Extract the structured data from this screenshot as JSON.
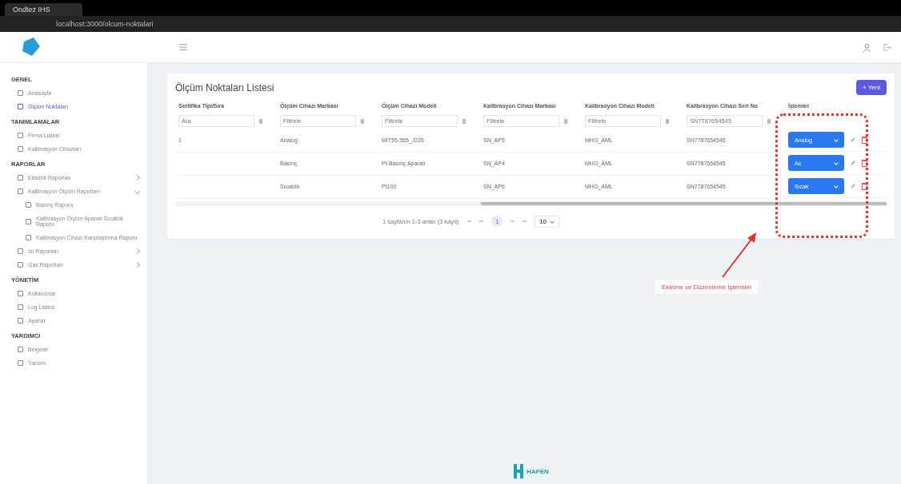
{
  "browser": {
    "tab_title": "Ondtez IHS",
    "address": "localhost:3000/olcum-noktalari"
  },
  "sidebar": {
    "sections": [
      {
        "title": "GENEL",
        "items": [
          {
            "kind": "link",
            "label": "Anasayfa",
            "selected": false
          },
          {
            "kind": "link",
            "label": "Ölçüm Noktaları",
            "selected": true
          }
        ]
      },
      {
        "title": "TANIMLAMALAR",
        "items": [
          {
            "kind": "link",
            "label": "Firma Listesi",
            "selected": false
          },
          {
            "kind": "link",
            "label": "Kalibrasyon Cihazları",
            "selected": false
          }
        ]
      },
      {
        "title": "RAPORLAR",
        "items": [
          {
            "kind": "group",
            "label": "Elektrik Raporları",
            "selected": false,
            "expanded": false
          },
          {
            "kind": "group",
            "label": "Kalibrasyon Ölçüm Raporları",
            "selected": false,
            "expanded": true,
            "children": [
              {
                "label": "Basınç Raporu",
                "selected": false
              },
              {
                "label": "Kalibrasyon Ölçüm Aparatı Sıcaklık Raporu",
                "selected": false
              },
              {
                "label": "Kalibrasyon Cihazı Karşılaştırma Raporu",
                "selected": false
              }
            ]
          },
          {
            "kind": "group",
            "label": "Isı Raporları",
            "selected": false,
            "expanded": false
          },
          {
            "kind": "group",
            "label": "Gaz Raporları",
            "selected": false,
            "expanded": false
          }
        ]
      },
      {
        "title": "YÖNETİM",
        "items": [
          {
            "kind": "link",
            "label": "Kullanıcılar",
            "selected": false
          },
          {
            "kind": "link",
            "label": "Log Listesi",
            "selected": false
          },
          {
            "kind": "link",
            "label": "Ayarlar",
            "selected": false
          }
        ]
      },
      {
        "title": "YARDIMCI",
        "items": [
          {
            "kind": "link",
            "label": "Belgeler",
            "selected": false
          },
          {
            "kind": "link",
            "label": "Yardım",
            "selected": false
          }
        ]
      }
    ]
  },
  "page": {
    "title": "Ölçüm Noktaları Listesi",
    "new_button": "+ Yeni",
    "table": {
      "columns": [
        {
          "label": "Sertifika Tipi/Sıra"
        },
        {
          "label": "Ölçüm Cihazı Markası"
        },
        {
          "label": "Ölçüm Cihazı Modeli"
        },
        {
          "label": "Kalibrasyon Cihazı Markası"
        },
        {
          "label": "Kalibrasyon Cihazı Modeli"
        },
        {
          "label": "Kalibrasyon Cihazı Seri No"
        },
        {
          "label": "İşlemler"
        }
      ],
      "filters": [
        {
          "placeholder": "Ara"
        },
        {
          "placeholder": "Filtrele"
        },
        {
          "placeholder": "Filtrele"
        },
        {
          "placeholder": "Filtrele"
        },
        {
          "placeholder": "Filtrele"
        },
        {
          "placeholder": "SN7787654545"
        }
      ],
      "rows": [
        {
          "cells": [
            "1",
            "Analog",
            "MIT55-555_J226",
            "SN_AP5",
            "MHG_AML",
            "SN7787654545"
          ],
          "action": "Analog"
        },
        {
          "cells": [
            "",
            "Basınç",
            "Pt-Basınç Aparatı",
            "SN_AP4",
            "MHG_AML",
            "SN7787654545"
          ],
          "action": "Ac"
        },
        {
          "cells": [
            "",
            "Sıcaklık",
            "Pt100",
            "SN_AP6",
            "MHG_AML",
            "SN7787654545"
          ],
          "action": "Sıcak"
        }
      ]
    },
    "pagination": {
      "summary": "1 sayfanın 1-3 arası (3 kayıt)",
      "pages": [
        {
          "label": "1",
          "selected": true
        }
      ],
      "page_size": "10"
    }
  },
  "annotation": {
    "text": "Ekleme ve Düzenleme İşlemleri"
  },
  "footer": {
    "logo_text": "HAFEN"
  }
}
